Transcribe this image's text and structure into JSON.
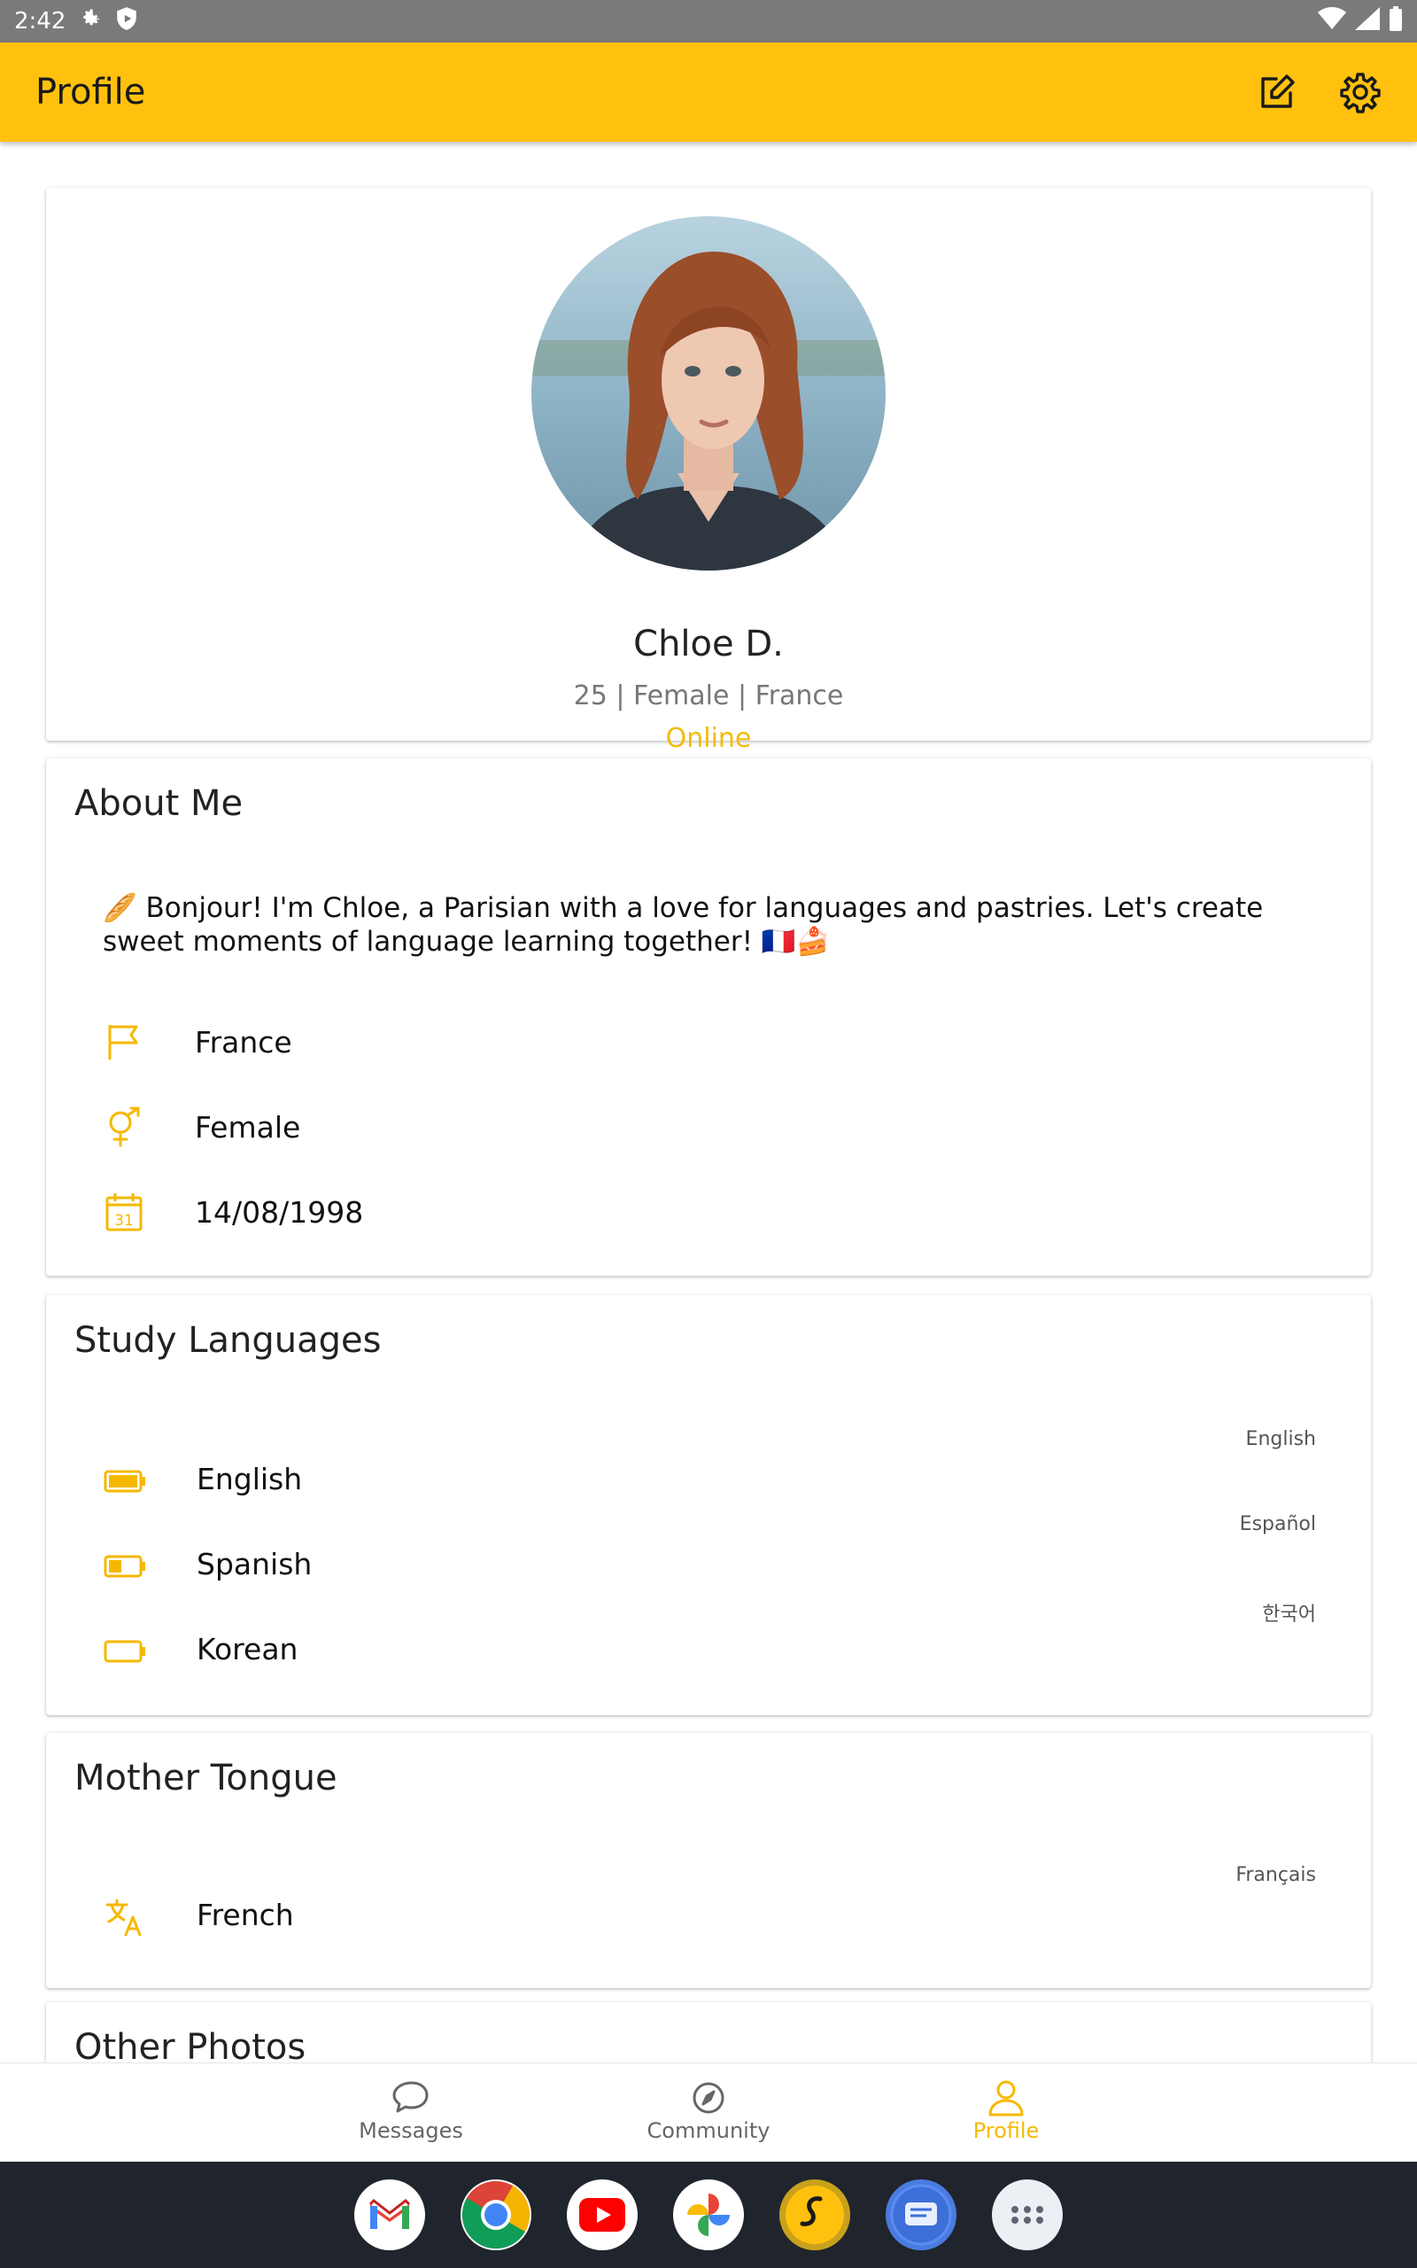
{
  "status_bar": {
    "time": "2:42"
  },
  "app_bar": {
    "title": "Profile",
    "edit_icon": "edit-icon",
    "settings_icon": "gear-icon"
  },
  "profile": {
    "name": "Chloe D.",
    "meta": "25 | Female | France",
    "status": "Online"
  },
  "about": {
    "title": "About Me",
    "bio": "🥖 Bonjour! I'm Chloe, a Parisian with a love for languages and pastries. Let's create sweet moments of language learning together! 🇫🇷🍰",
    "rows": [
      {
        "icon": "flag-icon",
        "text": "France"
      },
      {
        "icon": "gender-icon",
        "text": "Female"
      },
      {
        "icon": "calendar-icon",
        "text": "14/08/1998"
      }
    ]
  },
  "study": {
    "title": "Study Languages",
    "languages": [
      {
        "name": "English",
        "native": "English",
        "level": 0.85
      },
      {
        "name": "Spanish",
        "native": "Español",
        "level": 0.4
      },
      {
        "name": "Korean",
        "native": "한국어",
        "level": 0.0
      }
    ]
  },
  "mother": {
    "title": "Mother Tongue",
    "languages": [
      {
        "name": "French",
        "native": "Français"
      }
    ]
  },
  "photos": {
    "title": "Other Photos"
  },
  "nav": [
    {
      "label": "Messages",
      "icon": "chat-icon"
    },
    {
      "label": "Community",
      "icon": "compass-icon"
    },
    {
      "label": "Profile",
      "icon": "person-icon",
      "active": true
    }
  ],
  "colors": {
    "accent": "#ffc10d",
    "accent_text": "#f2bb0a"
  }
}
